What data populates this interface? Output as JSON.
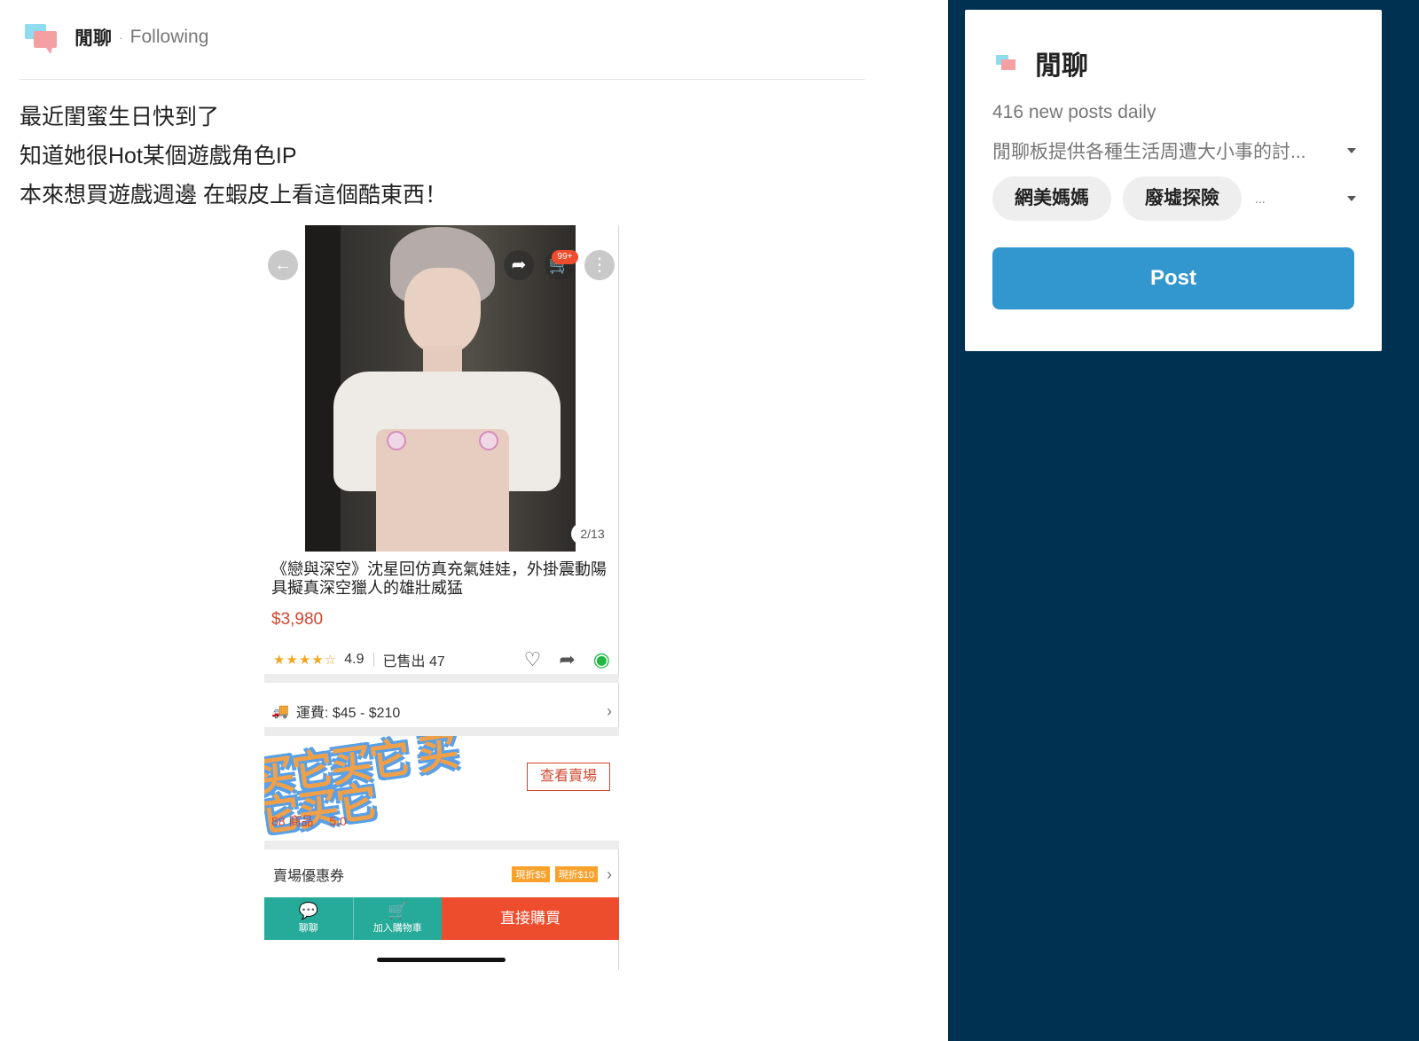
{
  "post": {
    "board_name": "閒聊",
    "separator": "·",
    "following": "Following",
    "lines": [
      "最近閨蜜生日快到了",
      "知道她很Hot某個遊戲角色IP",
      "本來想買遊戲週邊 在蝦皮上看這個酷東西！"
    ]
  },
  "shot": {
    "cart_badge": "99+",
    "page_count": "2/13",
    "product_title": "《戀與深空》沈星回仿真充氣娃娃，外掛震動陽具擬真深空獵人的雄壯威猛",
    "price": "$3,980",
    "stars": "★★★★☆",
    "rating": "4.9",
    "sold": "已售出 47",
    "shipping": "運費: $45 - $210",
    "sticker_text": "买它买它 买它买它",
    "shop_products": "88 商品",
    "shop_rating": "5.0",
    "view_shop": "查看賣場",
    "coupons_label": "賣場優惠券",
    "coupon_1": "現折$5",
    "coupon_2": "現折$10",
    "chat_label": "聊聊",
    "cart_label": "加入購物車",
    "buy_label": "直接購買"
  },
  "sidebar": {
    "board_name": "閒聊",
    "daily": "416 new posts daily",
    "description": "閒聊板提供各種生活周遭大小事的討...",
    "tags": [
      "網美媽媽",
      "廢墟探險"
    ],
    "more": "...",
    "post_button": "Post"
  },
  "colors": {
    "sidebar_bg": "#003150",
    "post_button": "#3397cf",
    "price": "#d0472f",
    "buy_button": "#ee4d2d",
    "chat_cart_bar": "#26aa99"
  }
}
